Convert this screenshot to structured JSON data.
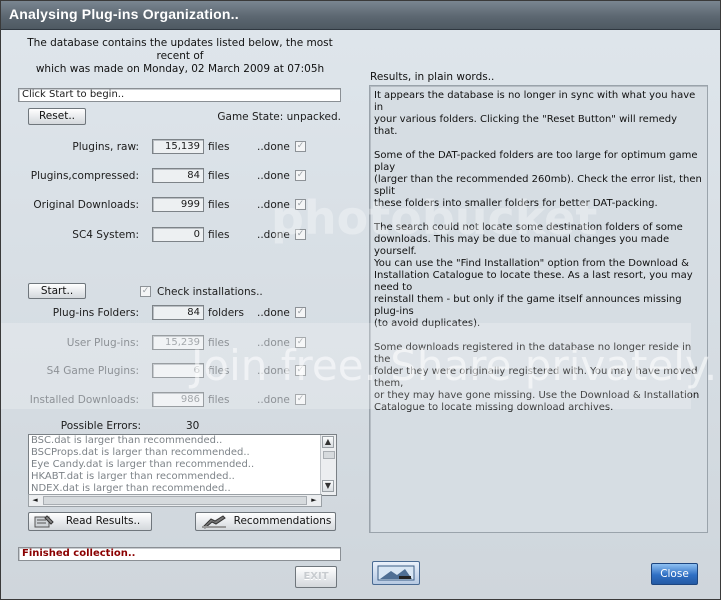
{
  "window": {
    "title": "Analysing Plug-ins Organization.."
  },
  "header": {
    "line1": "The database contains the updates listed below, the most recent of",
    "line2": "which was made on Monday, 02 March 2009 at 07:05h"
  },
  "status_top": "Click Start to begin..",
  "reset_button": "Reset..",
  "game_state": "Game State: unpacked.",
  "counts": [
    {
      "label": "Plugins, raw:",
      "value": "15,139",
      "unit": "files",
      "status": "..done",
      "dim": false
    },
    {
      "label": "Plugins,compressed:",
      "value": "84",
      "unit": "files",
      "status": "..done",
      "dim": false
    },
    {
      "label": "Original Downloads:",
      "value": "999",
      "unit": "files",
      "status": "..done",
      "dim": false
    },
    {
      "label": "SC4 System:",
      "value": "0",
      "unit": "files",
      "status": "..done",
      "dim": false
    }
  ],
  "start_button": "Start..",
  "check_installations": "Check installations..",
  "checks": [
    {
      "label": "Plug-ins Folders:",
      "value": "84",
      "unit": "folders",
      "status": "..done",
      "dim": false
    },
    {
      "label": "User Plug-ins:",
      "value": "15,239",
      "unit": "files",
      "status": "..done",
      "dim": true
    },
    {
      "label": "S4 Game Plugins:",
      "value": "6",
      "unit": "files",
      "status": "..done",
      "dim": true
    },
    {
      "label": "Installed Downloads:",
      "value": "986",
      "unit": "files",
      "status": "..done",
      "dim": true
    }
  ],
  "possible_errors": {
    "label": "Possible Errors:",
    "value": "30"
  },
  "errors_list": [
    "BSC.dat is larger than recommended..",
    "BSCProps.dat is larger than recommended..",
    "Eye Candy.dat is larger than recommended..",
    "HKABT.dat is larger than recommended..",
    "NDEX.dat is larger than recommended.."
  ],
  "read_results_button": "Read Results..",
  "recommendations_button": "Recommendations",
  "status_bottom": "Finished collection..",
  "exit_button": "EXIT",
  "close_button": "Close",
  "results": {
    "heading": "Results, in plain words..",
    "paragraphs": [
      "It appears the database is no longer in sync with what you have in\nyour various folders. Clicking the \"Reset Button\" will remedy that.",
      "Some of the DAT-packed folders are too large for optimum game play\n(larger than the recommended 260mb). Check the error list, then split\nthese folders into smaller folders for better DAT-packing.",
      "The search could not locate some destination folders of some\ndownloads. This may be due to manual changes you made yourself.\nYou can use the \"Find Installation\" option from the Download &\nInstallation Catalogue to locate these. As a last resort, you may need to\nreinstall them - but only if the game itself announces missing plug-ins\n(to avoid duplicates).",
      "Some downloads registered in the database no longer reside in the\nfolder they were originally registered with. You may have moved them,\nor they may have gone missing. Use the Download & Installation\nCatalogue to locate missing download archives."
    ]
  },
  "watermark": {
    "brand": "photobucket",
    "slogan": "Join free. Share privately."
  },
  "colors": {
    "status_bottom_text": "#8b0000",
    "close_blue": "#2f6fc4"
  }
}
